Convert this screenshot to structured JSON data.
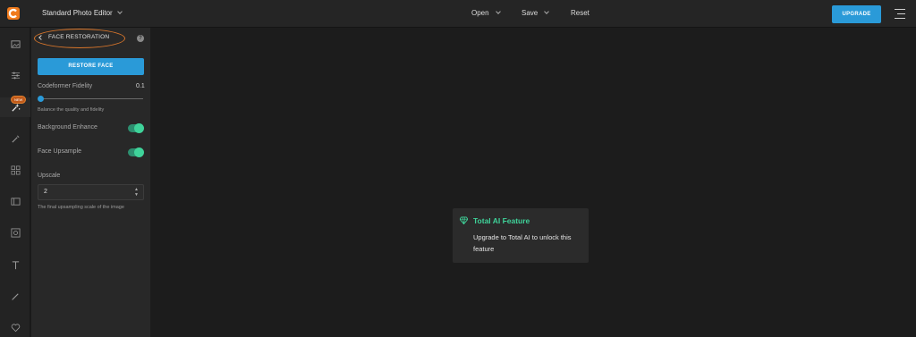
{
  "header": {
    "app_title": "Standard Photo Editor",
    "menu": {
      "open": "Open",
      "save": "Save",
      "reset": "Reset"
    },
    "upgrade_label": "UPGRADE"
  },
  "rail": {
    "items": [
      {
        "icon": "image-icon"
      },
      {
        "icon": "adjust-sliders-icon"
      },
      {
        "icon": "ai-magic-icon",
        "badge": "NEW",
        "active": true
      },
      {
        "icon": "wand-icon"
      },
      {
        "icon": "grid-icon"
      },
      {
        "icon": "frame-icon"
      },
      {
        "icon": "photo-frame-icon"
      },
      {
        "icon": "text-icon"
      },
      {
        "icon": "brush-icon"
      },
      {
        "icon": "heart-icon"
      }
    ]
  },
  "panel": {
    "title": "FACE RESTORATION",
    "help": "?",
    "restore_label": "RESTORE FACE",
    "fidelity": {
      "label": "Codeformer Fidelity",
      "value": "0.1",
      "value_fraction": 0.1,
      "hint": "Balance the quality and fidelity"
    },
    "background_enhance": {
      "label": "Background Enhance",
      "on": true
    },
    "face_upsample": {
      "label": "Face Upsample",
      "on": true
    },
    "upscale": {
      "label": "Upscale",
      "value": "2",
      "hint": "The final upsampling scale of the image"
    }
  },
  "ai_card": {
    "title": "Total AI Feature",
    "body": "Upgrade to Total AI to unlock this feature"
  },
  "colors": {
    "accent": "#2a9ad8",
    "ai_green": "#3fd39a",
    "highlight_oval": "#d9762b",
    "logo_orange": "#f07b1d"
  }
}
